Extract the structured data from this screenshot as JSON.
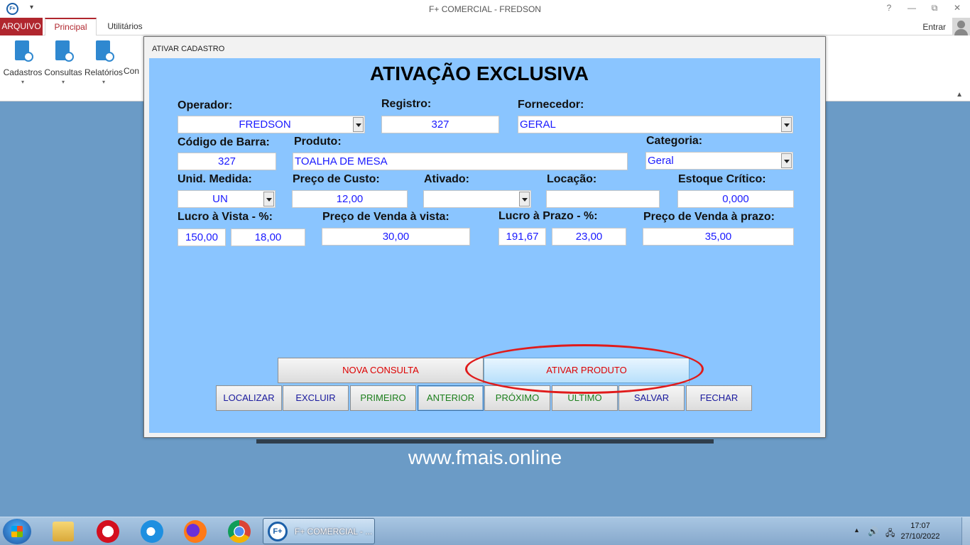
{
  "window": {
    "title": "F+ COMERCIAL - FREDSON",
    "logo_text": "F+",
    "controls": {
      "help": "?",
      "minimize": "—",
      "restore": "⧉",
      "close": "✕"
    }
  },
  "ribbon": {
    "file_tab": "ARQUIVO",
    "tabs": [
      {
        "label": "Principal"
      },
      {
        "label": "Utilitários"
      }
    ],
    "signin": "Entrar",
    "buttons": [
      {
        "label": "Cadastros"
      },
      {
        "label": "Consultas"
      },
      {
        "label": "Relatórios"
      },
      {
        "label": "Con"
      }
    ]
  },
  "dialog": {
    "title": "ATIVAR CADASTRO",
    "heading": "ATIVAÇÃO EXCLUSIVA",
    "labels": {
      "operador": "Operador:",
      "registro": "Registro:",
      "fornecedor": "Fornecedor:",
      "codigo_barra": "Código de Barra:",
      "produto": "Produto:",
      "categoria": "Categoria:",
      "unid_medida": "Unid. Medida:",
      "preco_custo": "Preço de Custo:",
      "ativado": "Ativado:",
      "locacao": "Locação:",
      "estoque_critico": "Estoque Crítico:",
      "lucro_vista": "Lucro à Vista - %:",
      "preco_venda_vista": "Preço de Venda à vista:",
      "lucro_prazo": "Lucro à Prazo - %:",
      "preco_venda_prazo": "Preço de Venda à prazo:"
    },
    "values": {
      "operador": "FREDSON",
      "registro": "327",
      "fornecedor": "GERAL",
      "codigo_barra": "327",
      "produto": "TOALHA DE MESA",
      "categoria": "Geral",
      "unid_medida": "UN",
      "preco_custo": "12,00",
      "ativado": "",
      "locacao": "",
      "estoque_critico": "0,000",
      "lucro_vista_pct": "150,00",
      "lucro_vista_valor": "18,00",
      "preco_venda_vista": "30,00",
      "lucro_prazo_pct": "191,67",
      "lucro_prazo_valor": "23,00",
      "preco_venda_prazo": "35,00"
    },
    "buttons": {
      "nova_consulta": "NOVA CONSULTA",
      "ativar_produto": "ATIVAR PRODUTO",
      "localizar": "LOCALIZAR",
      "excluir": "EXCLUIR",
      "primeiro": "PRIMEIRO",
      "anterior": "ANTERIOR",
      "proximo": "PRÓXIMO",
      "ultimo": "ÚLTIMO",
      "salvar": "SALVAR",
      "fechar": "FECHAR"
    }
  },
  "website": "www.fmais.online",
  "taskbar": {
    "active_app": "F+ COMERCIAL - ...",
    "app_logo": "F+",
    "time": "17:07",
    "date": "27/10/2022"
  }
}
